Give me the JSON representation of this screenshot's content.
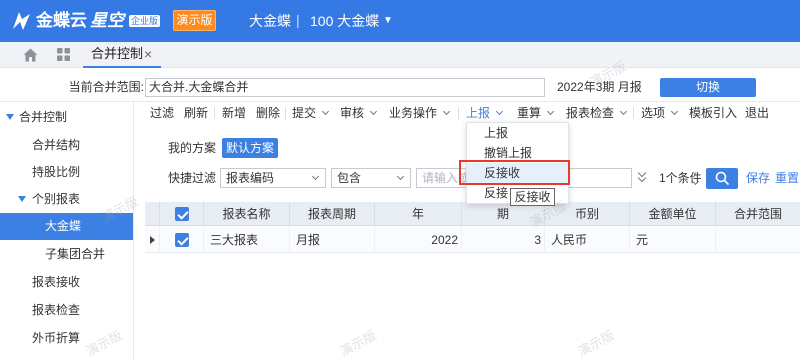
{
  "header": {
    "logo_icon": "kingdee-logo-icon",
    "product": "金蝶云",
    "product_sub": "星空",
    "edition": "企业版",
    "demo": "演示版",
    "org": "大金蝶",
    "divider": "|",
    "account": "100 大金蝶",
    "account_caret": "▼"
  },
  "tabbar": {
    "home_icon": "home-icon",
    "apps_icon": "grid-icon",
    "tabs": [
      {
        "label": "合并控制",
        "close": "×",
        "active": true
      }
    ]
  },
  "scope": {
    "label": "当前合并范围:",
    "value": "大合并.大金蝶合并",
    "period": "2022年3期 月报",
    "switch": "切换"
  },
  "toolbar": {
    "items": [
      {
        "label": "过滤",
        "dropdown": false
      },
      {
        "label": "刷新",
        "dropdown": false
      },
      {
        "label": "新增",
        "dropdown": false
      },
      {
        "label": "删除",
        "dropdown": false
      },
      {
        "label": "提交",
        "dropdown": true
      },
      {
        "label": "审核",
        "dropdown": true
      },
      {
        "label": "业务操作",
        "dropdown": true
      },
      {
        "label": "上报",
        "dropdown": true,
        "active": true
      },
      {
        "label": "重算",
        "dropdown": true
      },
      {
        "label": "报表检查",
        "dropdown": true
      },
      {
        "label": "选项",
        "dropdown": true
      },
      {
        "label": "模板引入",
        "dropdown": false
      },
      {
        "label": "退出",
        "dropdown": false
      }
    ]
  },
  "sidebar": {
    "items": [
      {
        "label": "合并控制",
        "level": 1,
        "expanded": true
      },
      {
        "label": "合并结构",
        "level": 2
      },
      {
        "label": "持股比例",
        "level": 2
      },
      {
        "label": "个别报表",
        "level": 2,
        "expanded": true
      },
      {
        "label": "大金蝶",
        "level": 3,
        "selected": true
      },
      {
        "label": "子集团合并",
        "level": 3
      },
      {
        "label": "报表接收",
        "level": 2
      },
      {
        "label": "报表检查",
        "level": 2
      },
      {
        "label": "外币折算",
        "level": 2
      }
    ]
  },
  "filter": {
    "scheme_label": "我的方案",
    "default_scheme": "默认方案",
    "quick_label": "快捷过滤",
    "field": "报表编码",
    "operator": "包含",
    "value_placeholder": "请输入或",
    "condition_count": "1个条件",
    "save": "保存",
    "reset": "重置"
  },
  "table": {
    "header_checked": true,
    "columns": [
      "报表名称",
      "报表周期",
      "年",
      "期",
      "币别",
      "金额单位",
      "合并范围"
    ],
    "rows": [
      {
        "checked": true,
        "cells": [
          "三大报表",
          "月报",
          "2022",
          "3",
          "人民币",
          "元",
          ""
        ]
      }
    ]
  },
  "report_menu": {
    "items": [
      {
        "label": "上报"
      },
      {
        "label": "撤销上报"
      },
      {
        "label": "反接收",
        "highlighted": true
      },
      {
        "label": "反接"
      }
    ]
  },
  "tooltip": {
    "text": "反接收"
  },
  "watermark": {
    "text": "演示版"
  },
  "colors": {
    "header": "#3479e4",
    "primary": "#3d80e3",
    "demo_button": "#ff8c1a",
    "highlight_box": "#e8382f"
  }
}
